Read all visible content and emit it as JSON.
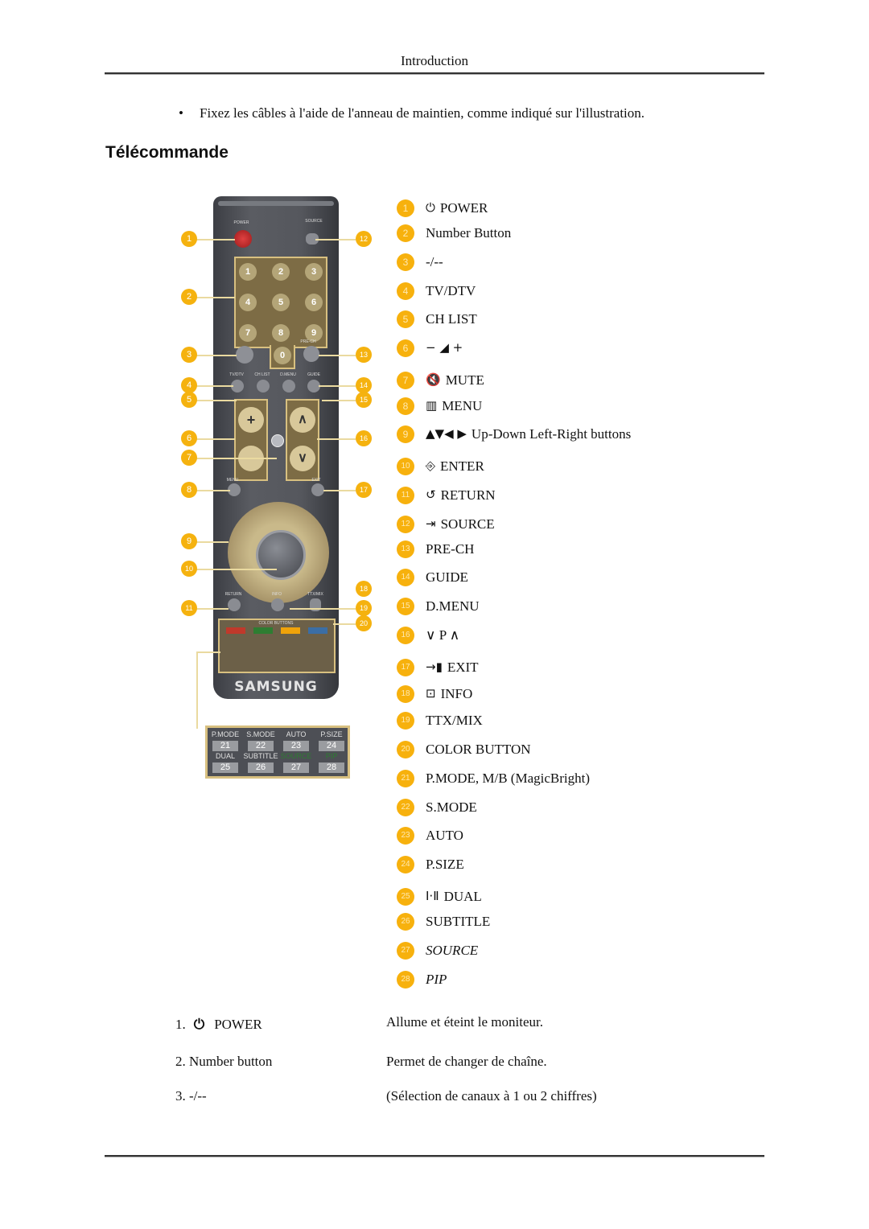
{
  "header": {
    "title": "Introduction"
  },
  "bullet": {
    "symbol": "•",
    "text": "Fixez les câbles à l'aide de l'anneau de maintien, comme indiqué sur l'illustration."
  },
  "section": {
    "title": "Télécommande"
  },
  "remote": {
    "brand": "SAMSUNG",
    "top_labels": {
      "power": "POWER",
      "source": "SOURCE"
    },
    "numbers": [
      "1",
      "2",
      "3",
      "4",
      "5",
      "6",
      "7",
      "8",
      "9",
      "0"
    ],
    "row_labels": [
      "TV/DTV",
      "CH LIST",
      "D.MENU",
      "GUIDE"
    ],
    "small_labels": {
      "prech": "PRE-CH",
      "mute": "MUTE",
      "menu": "MENU",
      "exit": "EXIT",
      "return": "RETURN",
      "info": "INFO",
      "ttx": "TTX/MIX",
      "color_buttons": "COLOR BUTTONS"
    },
    "color_keys": [
      "#c0392b",
      "#2e7d32",
      "#f0a30a",
      "#3b6ea5"
    ],
    "callouts_left": [
      "1",
      "2",
      "3",
      "4",
      "5",
      "6",
      "7",
      "8",
      "9",
      "10",
      "11"
    ],
    "callouts_right": [
      "12",
      "13",
      "14",
      "15",
      "16",
      "17",
      "18",
      "19",
      "20"
    ],
    "inset": {
      "labels": [
        "P.MODE",
        "S.MODE",
        "AUTO",
        "P.SIZE",
        "DUAL",
        "SUBTITLE",
        "SOURCE",
        "PIP"
      ],
      "numbers": [
        "21",
        "22",
        "23",
        "24",
        "25",
        "26",
        "27",
        "28"
      ]
    }
  },
  "legend": [
    {
      "num": "1",
      "icon": "power-icon",
      "glyph": "⏻",
      "label": "POWER"
    },
    {
      "num": "2",
      "label": "Number Button"
    },
    {
      "num": "3",
      "label": "-/--"
    },
    {
      "num": "4",
      "label": "TV/DTV"
    },
    {
      "num": "5",
      "label": "CH LIST"
    },
    {
      "num": "6",
      "icon": "volume-icon",
      "glyph": "−  ◢  +",
      "label": ""
    },
    {
      "num": "7",
      "icon": "mute-icon",
      "glyph": "🔇",
      "label": "MUTE"
    },
    {
      "num": "8",
      "icon": "menu-icon",
      "glyph": "▥",
      "label": "MENU"
    },
    {
      "num": "9",
      "icon": "arrows-icon",
      "glyph": "▲▼◀ ▶",
      "label": "Up-Down Left-Right buttons"
    },
    {
      "num": "10",
      "icon": "enter-icon",
      "glyph": "⎆",
      "label": "ENTER"
    },
    {
      "num": "11",
      "icon": "return-icon",
      "glyph": "↺",
      "label": "RETURN"
    },
    {
      "num": "12",
      "icon": "source-icon",
      "glyph": "⇥",
      "label": "SOURCE"
    },
    {
      "num": "13",
      "label": "PRE-CH"
    },
    {
      "num": "14",
      "label": "GUIDE"
    },
    {
      "num": "15",
      "label": "D.MENU"
    },
    {
      "num": "16",
      "icon": "channel-icon",
      "glyph": "",
      "label": "∨ P ∧"
    },
    {
      "num": "17",
      "icon": "exit-icon",
      "glyph": "→▮",
      "label": "EXIT"
    },
    {
      "num": "18",
      "icon": "info-icon",
      "glyph": "⊡",
      "label": "INFO"
    },
    {
      "num": "19",
      "label": "TTX/MIX"
    },
    {
      "num": "20",
      "label": "COLOR BUTTON"
    },
    {
      "num": "21",
      "label": "P.MODE, M/B (MagicBright)"
    },
    {
      "num": "22",
      "label": "S.MODE"
    },
    {
      "num": "23",
      "label": "AUTO"
    },
    {
      "num": "24",
      "label": "P.SIZE"
    },
    {
      "num": "25",
      "icon": "dual-icon",
      "glyph": "Ⅰ·Ⅱ",
      "label": "DUAL"
    },
    {
      "num": "26",
      "label": "SUBTITLE"
    },
    {
      "num": "27",
      "label": "SOURCE",
      "italic": true
    },
    {
      "num": "28",
      "label": "PIP",
      "italic": true
    }
  ],
  "descriptions": [
    {
      "name": "1.",
      "icon": "power-icon",
      "glyph": "⏻",
      "label": "POWER",
      "text": "Allume et éteint le moniteur."
    },
    {
      "name": "2. Number button",
      "text": "Permet de changer de chaîne."
    },
    {
      "name": "3. -/--",
      "text": "(Sélection de canaux à 1 ou 2 chiffres)"
    }
  ]
}
